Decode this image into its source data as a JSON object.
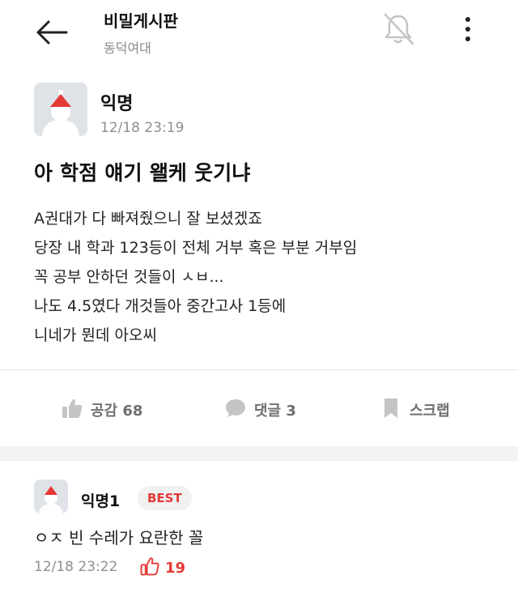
{
  "header": {
    "board_title": "비밀게시판",
    "board_subtitle": "동덕여대"
  },
  "post": {
    "author": "익명",
    "time": "12/18 23:19",
    "title": "아 학점 얘기 왤케 웃기냐",
    "body": [
      "A권대가 다 빠져줬으니 잘 보셨겠죠",
      "당장 내 학과 123등이 전체 거부 혹은 부분 거부임",
      "꼭 공부 안하던 것들이 ㅅㅂ...",
      "나도 4.5였다 개것들아 중간고사 1등에",
      "니네가 뭔데 아오씨"
    ]
  },
  "actions": {
    "like_label": "공감 68",
    "comment_label": "댓글 3",
    "scrap_label": "스크랩"
  },
  "comment": {
    "author": "익명1",
    "badge": "BEST",
    "text": "ㅇㅈ 빈 수레가 요란한 꼴",
    "time": "12/18 23:22",
    "likes": "19"
  },
  "colors": {
    "accent": "#e53935",
    "muted": "#8f8f8f",
    "avatar_bg": "#dfe3e7"
  }
}
